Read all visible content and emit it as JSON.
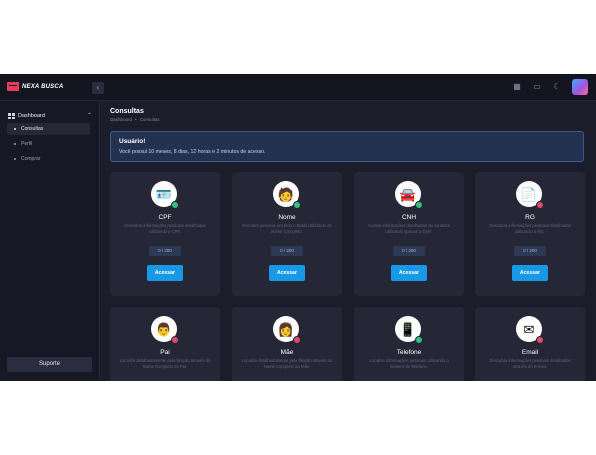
{
  "app": {
    "logo_text": "NEXA BUSCA",
    "accent": "#1799e8"
  },
  "topbar": {
    "collapse_icon": "chevron-left-icon",
    "icons": [
      "apps-grid-icon",
      "chat-icon",
      "moon-icon"
    ]
  },
  "sidebar": {
    "group_label": "Dashboard",
    "items": [
      {
        "label": "Consultas",
        "active": true
      },
      {
        "label": "Perfil",
        "active": false
      },
      {
        "label": "Comprar",
        "active": false
      }
    ],
    "support_label": "Suporte"
  },
  "main": {
    "title": "Consultas",
    "breadcrumb": [
      "Dashboard",
      "•",
      "Consultas"
    ],
    "alert": {
      "title": "Usuário!",
      "text": "Você possui 10 meses, 8 dias, 12 horas e 2 minutos de acesso."
    },
    "cards": [
      {
        "title": "CPF",
        "desc": "Descubra informações pessoais detalhadas utilizando o CPF.",
        "counter": "0 / 200",
        "button": "Acessar",
        "icon": "id-card-icon",
        "status": "green"
      },
      {
        "title": "Nome",
        "desc": "Encontre pessoas em todo o Brasil utilizando do Nome Completo.",
        "counter": "0 / 200",
        "button": "Acessar",
        "icon": "person-badge-icon",
        "status": "green"
      },
      {
        "title": "CNH",
        "desc": "Acesse informações detalhadas do condutor utilizando apenas o CNH.",
        "counter": "0 / 200",
        "button": "Acessar",
        "icon": "driver-license-icon",
        "status": "green"
      },
      {
        "title": "RG",
        "desc": "Descubra informações pessoais detalhadas utilizando o RG.",
        "counter": "0 / 200",
        "button": "Acessar",
        "icon": "document-icon",
        "status": "red"
      },
      {
        "title": "Pai",
        "desc": "Localize detalhadamente pela filiação através do Nome Completo do Pai.",
        "icon": "father-icon",
        "status": "red"
      },
      {
        "title": "Mãe",
        "desc": "Localize detalhadamente pela filiação através do Nome Completo da Mãe.",
        "icon": "mother-icon",
        "status": "red"
      },
      {
        "title": "Telefone",
        "desc": "Localize informações pessoais utilizando o número de Telefone.",
        "icon": "phone-icon",
        "status": "green"
      },
      {
        "title": "Email",
        "desc": "Descubra informações pessoais detalhadas através do E-mail.",
        "icon": "email-icon",
        "status": "red"
      }
    ]
  }
}
